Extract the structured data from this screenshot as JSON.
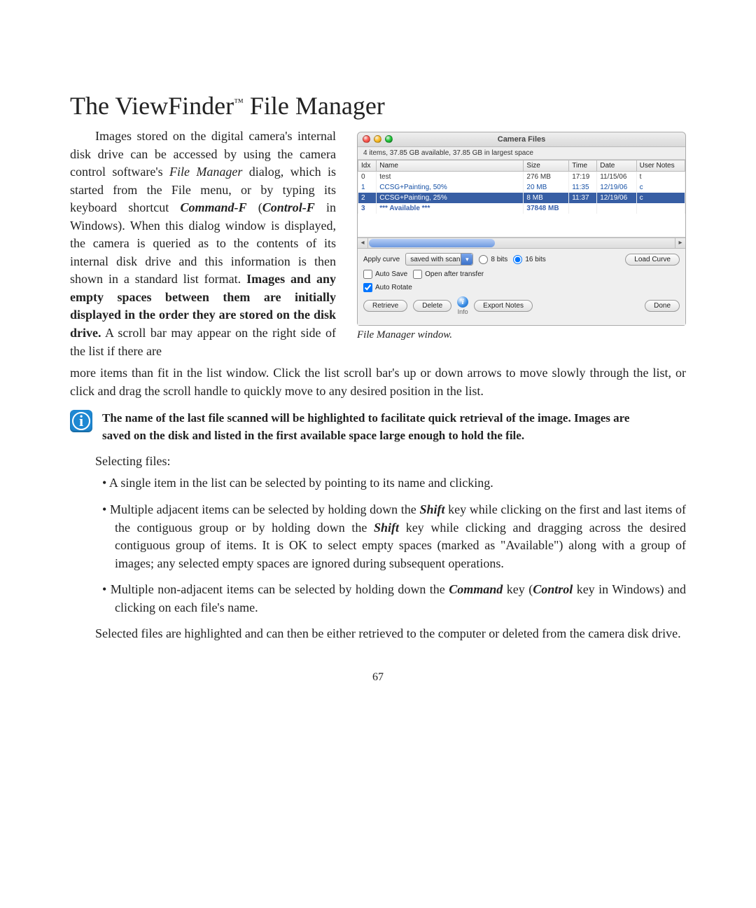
{
  "heading": {
    "pre": "The ViewFinder",
    "tm": "™",
    "post": " File Manager"
  },
  "intro_left": "Images stored on the digital camera's internal disk drive can be accessed by using the camera control software's ",
  "intro_fm": "File Manager",
  "intro_mid": " dialog, which is started from the File menu, or by typing its keyboard shortcut ",
  "intro_kb": "Command-F",
  "intro_par": " (",
  "intro_kb2": "Control-F",
  "intro_after": " in Windows). When this dialog window is displayed, the camera is queried as to the contents of its internal disk drive and this information is then shown in a standard list format. ",
  "intro_bold": "Images and any empty spaces between them are initially displayed in the order they are stored on the disk drive.",
  "intro_tail": " A scroll bar may appear on the right side of the list if there are",
  "after_float": "more items than fit in the list window. Click the list scroll bar's up or down arrows to move slowly through the list, or click and drag the scroll handle to quickly move to any desired position in the list.",
  "note": "The name of the last file scanned will be highlighted to facilitate quick retrieval of the image. Images are saved on the disk and listed in the first available space large enough to hold the file.",
  "select_lead": "Selecting files:",
  "bullets": {
    "b1": "A single item in the list can be selected by pointing to its name and clicking.",
    "b2a": "Multiple adjacent items can be selected by holding down the ",
    "b2k1": "Shift",
    "b2b": " key while clicking on the first and last items of the contiguous group or by holding down the ",
    "b2k2": "Shift",
    "b2c": " key while clicking and dragging across the desired contiguous group of items. It is OK to select empty spaces (marked as \"Available\") along with a group of images; any selected empty spaces are ignored during subsequent operations.",
    "b3a": "Multiple non-adjacent items can be selected by holding down the ",
    "b3k1": "Command",
    "b3b": " key (",
    "b3k2": "Control",
    "b3c": " key in Windows) and clicking on each file's name."
  },
  "closing": "Selected files are highlighted and can then be either retrieved to the computer or deleted from the camera disk drive.",
  "page_number": "67",
  "window": {
    "title": "Camera Files",
    "status": "4 items, 37.85 GB available, 37.85 GB in largest space",
    "headers": {
      "idx": "Idx",
      "name": "Name",
      "size": "Size",
      "time": "Time",
      "date": "Date",
      "notes": "User Notes"
    },
    "rows": [
      {
        "idx": "0",
        "name": "test",
        "size": "276 MB",
        "time": "17:19",
        "date": "11/15/06",
        "notes": "t"
      },
      {
        "idx": "1",
        "name": "CCSG+Painting, 50%",
        "size": "20 MB",
        "time": "11:35",
        "date": "12/19/06",
        "notes": "c"
      },
      {
        "idx": "2",
        "name": "CCSG+Painting, 25%",
        "size": "8 MB",
        "time": "11:37",
        "date": "12/19/06",
        "notes": "c"
      },
      {
        "idx": "3",
        "name": "*** Available ***",
        "size": "37848 MB",
        "time": "",
        "date": "",
        "notes": ""
      }
    ],
    "apply_label": "Apply curve",
    "curve_sel": "saved with scan",
    "bits8": "8 bits",
    "bits16": "16 bits",
    "load_curve": "Load Curve",
    "autosave": "Auto Save",
    "openafter": "Open after transfer",
    "autorotate": "Auto Rotate",
    "retrieve": "Retrieve",
    "delete": "Delete",
    "info": "Info",
    "export": "Export Notes",
    "done": "Done"
  },
  "caption": "File Manager window."
}
